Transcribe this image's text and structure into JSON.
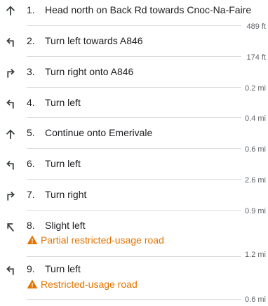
{
  "colors": {
    "text": "#202124",
    "secondary": "#5f6368",
    "divider": "#dadce0",
    "warning": "#e37400"
  },
  "steps": [
    {
      "number": "1.",
      "instruction": "Head north on Back Rd towards Cnoc-Na-Faire",
      "icon": "straight-arrow-icon",
      "distance": "489 ft"
    },
    {
      "number": "2.",
      "instruction": "Turn left towards A846",
      "icon": "turn-left-icon",
      "distance": "174 ft"
    },
    {
      "number": "3.",
      "instruction": "Turn right onto A846",
      "icon": "turn-right-icon",
      "distance": "0.2 mi"
    },
    {
      "number": "4.",
      "instruction": "Turn left",
      "icon": "turn-left-icon",
      "distance": "0.4 mi"
    },
    {
      "number": "5.",
      "instruction": "Continue onto Emerivale",
      "icon": "straight-arrow-icon",
      "distance": "0.6 mi"
    },
    {
      "number": "6.",
      "instruction": "Turn left",
      "icon": "turn-left-icon",
      "distance": "2.6 mi"
    },
    {
      "number": "7.",
      "instruction": "Turn right",
      "icon": "turn-right-icon",
      "distance": "0.9 mi"
    },
    {
      "number": "8.",
      "instruction": "Slight left",
      "icon": "slight-left-icon",
      "warning": "Partial restricted-usage road",
      "distance": "1.2 mi"
    },
    {
      "number": "9.",
      "instruction": "Turn left",
      "icon": "turn-left-icon",
      "warning": "Restricted-usage road",
      "distance": "0.6 mi"
    }
  ]
}
